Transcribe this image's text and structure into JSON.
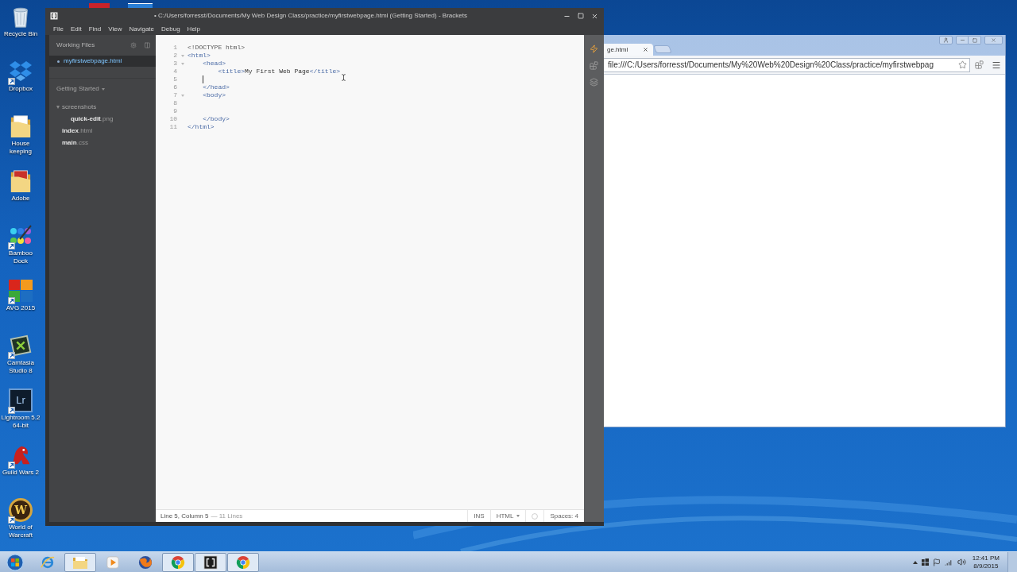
{
  "desktop": {
    "icons": [
      {
        "label": "Recycle Bin",
        "kind": "recycle-bin",
        "shortcut": false
      },
      {
        "label": "Dropbox",
        "kind": "dropbox",
        "shortcut": true
      },
      {
        "label": "House keeping",
        "kind": "folder",
        "shortcut": false
      },
      {
        "label": "Adobe",
        "kind": "folder-red",
        "shortcut": false
      },
      {
        "label": "Bamboo Dock",
        "kind": "bamboo",
        "shortcut": true
      },
      {
        "label": "AVG 2015",
        "kind": "avg",
        "shortcut": true
      },
      {
        "label": "Camtasia Studio 8",
        "kind": "camtasia",
        "shortcut": true
      },
      {
        "label": "Lightroom 5.2 64-bit",
        "kind": "lightroom",
        "shortcut": true,
        "logo_text": "Lr"
      },
      {
        "label": "Guild Wars 2",
        "kind": "guild-wars",
        "shortcut": true
      },
      {
        "label": "World of Warcraft",
        "kind": "wow",
        "shortcut": true,
        "logo_text": "W"
      }
    ]
  },
  "brackets": {
    "title": "• C:/Users/forresst/Documents/My Web Design Class/practice/myfirstwebpage.html (Getting Started) - Brackets",
    "menu": [
      "File",
      "Edit",
      "Find",
      "View",
      "Navigate",
      "Debug",
      "Help"
    ],
    "sidebar": {
      "working_files_title": "Working Files",
      "working_files": [
        {
          "name": "myfirstwebpage.html",
          "selected": true,
          "modified": true
        }
      ],
      "project_title": "Getting Started",
      "tree": [
        {
          "kind": "folder",
          "name": "screenshots",
          "expanded": true,
          "children": [
            {
              "kind": "file",
              "name": "quick-edit",
              "ext": ".png"
            }
          ]
        },
        {
          "kind": "file",
          "name": "index",
          "ext": ".html"
        },
        {
          "kind": "file",
          "name": "main",
          "ext": ".css"
        }
      ]
    },
    "editor": {
      "lines": [
        {
          "number": "1",
          "fold": false,
          "cursor": false,
          "tokens": [
            {
              "kind": "meta",
              "text": "<!DOCTYPE html>"
            }
          ]
        },
        {
          "number": "2",
          "fold": true,
          "cursor": false,
          "tokens": [
            {
              "kind": "tag",
              "text": "<html>"
            }
          ]
        },
        {
          "number": "3",
          "fold": true,
          "cursor": false,
          "tokens": [
            {
              "kind": "tag",
              "text": "    <head>"
            }
          ]
        },
        {
          "number": "4",
          "fold": false,
          "cursor": false,
          "tokens": [
            {
              "kind": "tag",
              "text": "        <title>"
            },
            {
              "kind": "text",
              "text": "My First Web Page"
            },
            {
              "kind": "tag",
              "text": "</title>"
            }
          ]
        },
        {
          "number": "5",
          "fold": false,
          "cursor": true
        },
        {
          "number": "6",
          "fold": false,
          "cursor": false,
          "tokens": [
            {
              "kind": "tag",
              "text": "    </head>"
            }
          ]
        },
        {
          "number": "7",
          "fold": true,
          "cursor": false,
          "tokens": [
            {
              "kind": "tag",
              "text": "    <body>"
            }
          ]
        },
        {
          "number": "8",
          "fold": false,
          "cursor": false
        },
        {
          "number": "9",
          "fold": false,
          "cursor": false
        },
        {
          "number": "10",
          "fold": false,
          "cursor": false,
          "tokens": [
            {
              "kind": "tag",
              "text": "    </body>"
            }
          ]
        },
        {
          "number": "11",
          "fold": false,
          "cursor": false,
          "tokens": [
            {
              "kind": "tag",
              "text": "</html>"
            }
          ]
        }
      ]
    },
    "status_bar": {
      "position": "Line 5, Column 5",
      "line_count": "— 11 Lines",
      "mode": "INS",
      "language": "HTML",
      "indentation": "Spaces: 4"
    }
  },
  "browser": {
    "tab": {
      "title": "ge.html"
    },
    "address": "file:///C:/Users/forresst/Documents/My%20Web%20Design%20Class/practice/myfirstwebpag"
  },
  "taskbar": {
    "apps": [
      {
        "kind": "ie",
        "running": false
      },
      {
        "kind": "explorer",
        "running": true
      },
      {
        "kind": "media-player",
        "running": false
      },
      {
        "kind": "firefox",
        "running": false
      },
      {
        "kind": "chrome",
        "running": true
      },
      {
        "kind": "brackets",
        "running": true
      },
      {
        "kind": "chrome",
        "running": true
      }
    ],
    "clock": {
      "time": "12:41 PM",
      "date": "8/9/2015"
    }
  }
}
